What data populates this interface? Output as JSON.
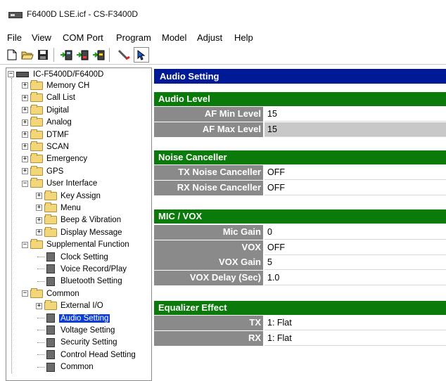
{
  "window": {
    "title": "F6400D LSE.icf - CS-F3400D"
  },
  "menu": [
    "File",
    "View",
    "COM Port",
    "Program",
    "Model",
    "Adjust",
    "Help"
  ],
  "toolbar": [
    {
      "icon": "new-file-icon"
    },
    {
      "icon": "open-folder-icon"
    },
    {
      "icon": "save-icon"
    },
    {
      "icon": "read-from-radio-icon"
    },
    {
      "icon": "write-to-radio-icon"
    },
    {
      "icon": "clone-icon"
    },
    {
      "icon": "wrench-icon"
    },
    {
      "icon": "pointer-help-icon"
    }
  ],
  "tree": {
    "root": "IC-F5400D/F6400D",
    "items": [
      {
        "label": "Memory CH",
        "type": "folder",
        "level": 1,
        "expander": "+"
      },
      {
        "label": "Call List",
        "type": "folder",
        "level": 1,
        "expander": "+"
      },
      {
        "label": "Digital",
        "type": "folder",
        "level": 1,
        "expander": "+"
      },
      {
        "label": "Analog",
        "type": "folder",
        "level": 1,
        "expander": "+"
      },
      {
        "label": "DTMF",
        "type": "folder",
        "level": 1,
        "expander": "+"
      },
      {
        "label": "SCAN",
        "type": "folder",
        "level": 1,
        "expander": "+"
      },
      {
        "label": "Emergency",
        "type": "folder",
        "level": 1,
        "expander": "+"
      },
      {
        "label": "GPS",
        "type": "folder",
        "level": 1,
        "expander": "+"
      },
      {
        "label": "User Interface",
        "type": "folder",
        "level": 1,
        "expander": "-"
      },
      {
        "label": "Key Assign",
        "type": "folder",
        "level": 2,
        "expander": "+"
      },
      {
        "label": "Menu",
        "type": "folder",
        "level": 2,
        "expander": "+"
      },
      {
        "label": "Beep & Vibration",
        "type": "folder",
        "level": 2,
        "expander": "+"
      },
      {
        "label": "Display Message",
        "type": "folder",
        "level": 2,
        "expander": "+"
      },
      {
        "label": "Supplemental Function",
        "type": "folder",
        "level": 1,
        "expander": "-"
      },
      {
        "label": "Clock Setting",
        "type": "doc",
        "level": 2
      },
      {
        "label": "Voice Record/Play",
        "type": "doc",
        "level": 2
      },
      {
        "label": "Bluetooth Setting",
        "type": "doc",
        "level": 2
      },
      {
        "label": "Common",
        "type": "folder",
        "level": 1,
        "expander": "-"
      },
      {
        "label": "External I/O",
        "type": "folder",
        "level": 2,
        "expander": "+"
      },
      {
        "label": "Audio Setting",
        "type": "doc",
        "level": 2,
        "selected": true
      },
      {
        "label": "Voltage Setting",
        "type": "doc",
        "level": 2
      },
      {
        "label": "Security Setting",
        "type": "doc",
        "level": 2
      },
      {
        "label": "Control Head Setting",
        "type": "doc",
        "level": 2
      },
      {
        "label": "Common",
        "type": "doc",
        "level": 2
      }
    ]
  },
  "panel": {
    "header": "Audio Setting",
    "sections": [
      {
        "title": "Audio Level",
        "rows": [
          {
            "label": "AF Min Level",
            "value": "15"
          },
          {
            "label": "AF Max Level",
            "value": "15"
          }
        ]
      },
      {
        "title": "Noise Canceller",
        "rows": [
          {
            "label": "TX Noise Canceller",
            "value": "OFF"
          },
          {
            "label": "RX Noise Canceller",
            "value": "OFF"
          }
        ]
      },
      {
        "title": "MIC / VOX",
        "rows": [
          {
            "label": "Mic Gain",
            "value": "0"
          },
          {
            "label": "VOX",
            "value": "OFF"
          },
          {
            "label": "VOX Gain",
            "value": "5"
          },
          {
            "label": "VOX Delay (Sec)",
            "value": "1.0"
          }
        ]
      },
      {
        "title": "Equalizer Effect",
        "rows": [
          {
            "label": "TX",
            "value": "1: Flat"
          },
          {
            "label": "RX",
            "value": "1: Flat"
          }
        ]
      }
    ]
  },
  "colors": {
    "header_bg": "#001a97",
    "section_bg": "#0a7a0a",
    "label_bg": "#8a8a8a",
    "selection_bg": "#0a3dd8"
  }
}
